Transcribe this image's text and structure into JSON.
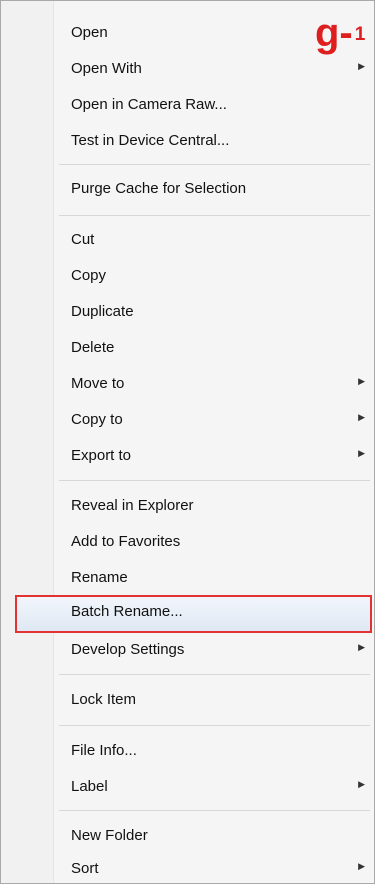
{
  "badge": {
    "letter": "g-",
    "number": "1",
    "color": "#dd1f1f"
  },
  "menu": {
    "items": [
      {
        "label": "Open",
        "submenu": false
      },
      {
        "label": "Open With",
        "submenu": true
      },
      {
        "label": "Open in Camera Raw...",
        "submenu": false
      },
      {
        "label": "Test in Device Central...",
        "submenu": false
      },
      {
        "label": "Purge Cache for Selection",
        "submenu": false
      },
      {
        "label": "Cut",
        "submenu": false
      },
      {
        "label": "Copy",
        "submenu": false
      },
      {
        "label": "Duplicate",
        "submenu": false
      },
      {
        "label": "Delete",
        "submenu": false
      },
      {
        "label": "Move to",
        "submenu": true
      },
      {
        "label": "Copy to",
        "submenu": true
      },
      {
        "label": "Export to",
        "submenu": true
      },
      {
        "label": "Reveal in Explorer",
        "submenu": false
      },
      {
        "label": "Add to Favorites",
        "submenu": false
      },
      {
        "label": "Rename",
        "submenu": false
      },
      {
        "label": "Batch Rename...",
        "submenu": false,
        "highlighted": true
      },
      {
        "label": "Develop Settings",
        "submenu": true
      },
      {
        "label": "Lock Item",
        "submenu": false
      },
      {
        "label": "File Info...",
        "submenu": false
      },
      {
        "label": "Label",
        "submenu": true
      },
      {
        "label": "New Folder",
        "submenu": false
      },
      {
        "label": "Sort",
        "submenu": true
      }
    ],
    "submenu_arrow": "▶",
    "highlight_border_color": "#e23232"
  }
}
